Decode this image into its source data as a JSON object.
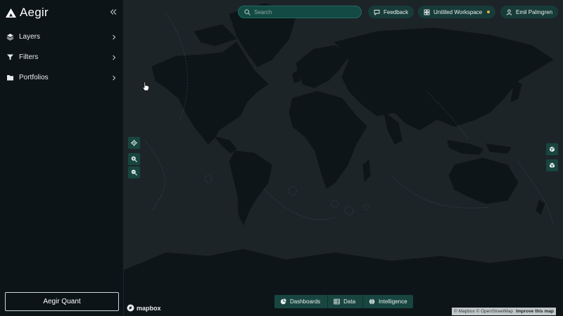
{
  "app": {
    "name": "Aegir"
  },
  "sidebar": {
    "collapse_icon": "double-chevron-left-icon",
    "items": [
      {
        "label": "Layers",
        "icon": "layers-icon"
      },
      {
        "label": "Filters",
        "icon": "filter-icon"
      },
      {
        "label": "Portfolios",
        "icon": "folder-icon"
      }
    ],
    "footer_button": "Aegir Quant"
  },
  "topbar": {
    "search_placeholder": "Search",
    "feedback_label": "Feedback",
    "workspace_label": "Untitled Workspace",
    "user_label": "Emil Palmgren"
  },
  "map_controls": {
    "left": [
      "locate-icon",
      "zoom-in-icon",
      "zoom-out-icon"
    ],
    "right": [
      "layers-toggle-icon",
      "cube-icon"
    ]
  },
  "bottom_tabs": [
    {
      "label": "Dashboards",
      "icon": "pie-chart-icon"
    },
    {
      "label": "Data",
      "icon": "table-icon"
    },
    {
      "label": "Intelligence",
      "icon": "globe-icon"
    }
  ],
  "footer": {
    "mapbox_logo": "mapbox",
    "attribution": "© Mapbox © OpenStreetMap",
    "improve": "Improve this map"
  },
  "colors": {
    "sidebar_bg": "#0d1417",
    "map_bg": "#1d2428",
    "land": "#0e1518",
    "accent": "#18453f",
    "workspace_dot": "#e0b43a"
  }
}
